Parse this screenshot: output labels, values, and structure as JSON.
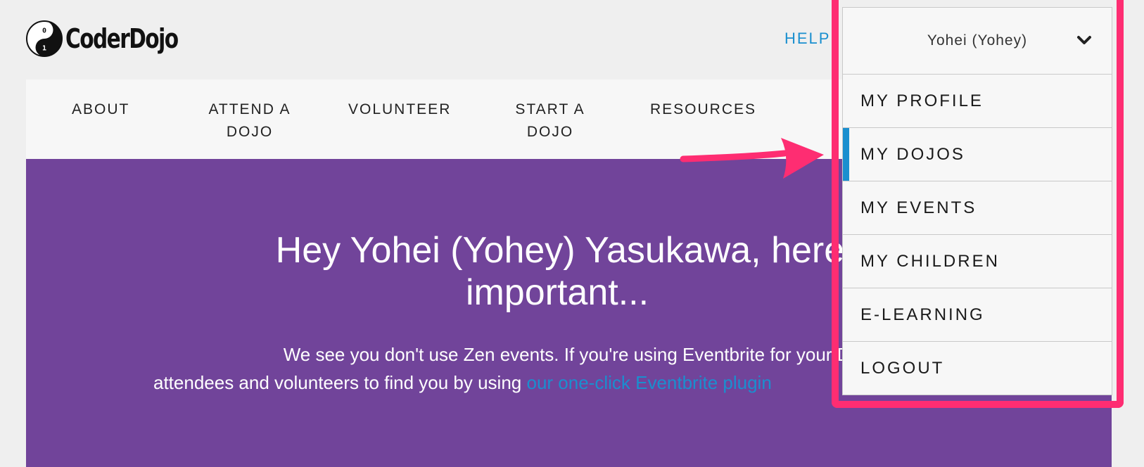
{
  "header": {
    "logo_text": "CoderDojo",
    "help_label": "HELP"
  },
  "nav": {
    "items": [
      "ABOUT",
      "ATTEND A\nDOJO",
      "VOLUNTEER",
      "START A DOJO",
      "RESOURCES"
    ]
  },
  "hero": {
    "title_line1": "Hey Yohei (Yohey) Yasukawa, here's wh",
    "title_line2": "important...",
    "sub_line1": "We see you don't use Zen events. If you're using Eventbrite for your Dojo you ca",
    "sub_line2_prefix": "attendees and volunteers to find you by using ",
    "sub_link": "our one-click Eventbrite plugin"
  },
  "dropdown": {
    "user_label": "Yohei (Yohey)",
    "items": [
      {
        "label": "MY PROFILE",
        "active": false
      },
      {
        "label": "MY DOJOS",
        "active": true
      },
      {
        "label": "MY EVENTS",
        "active": false
      },
      {
        "label": "MY CHILDREN",
        "active": false
      },
      {
        "label": "E-LEARNING",
        "active": false
      },
      {
        "label": "LOGOUT",
        "active": false
      }
    ]
  },
  "colors": {
    "accent_blue": "#1a8fcf",
    "hero_purple": "#71449a",
    "annotation_pink": "#fe2d72"
  }
}
